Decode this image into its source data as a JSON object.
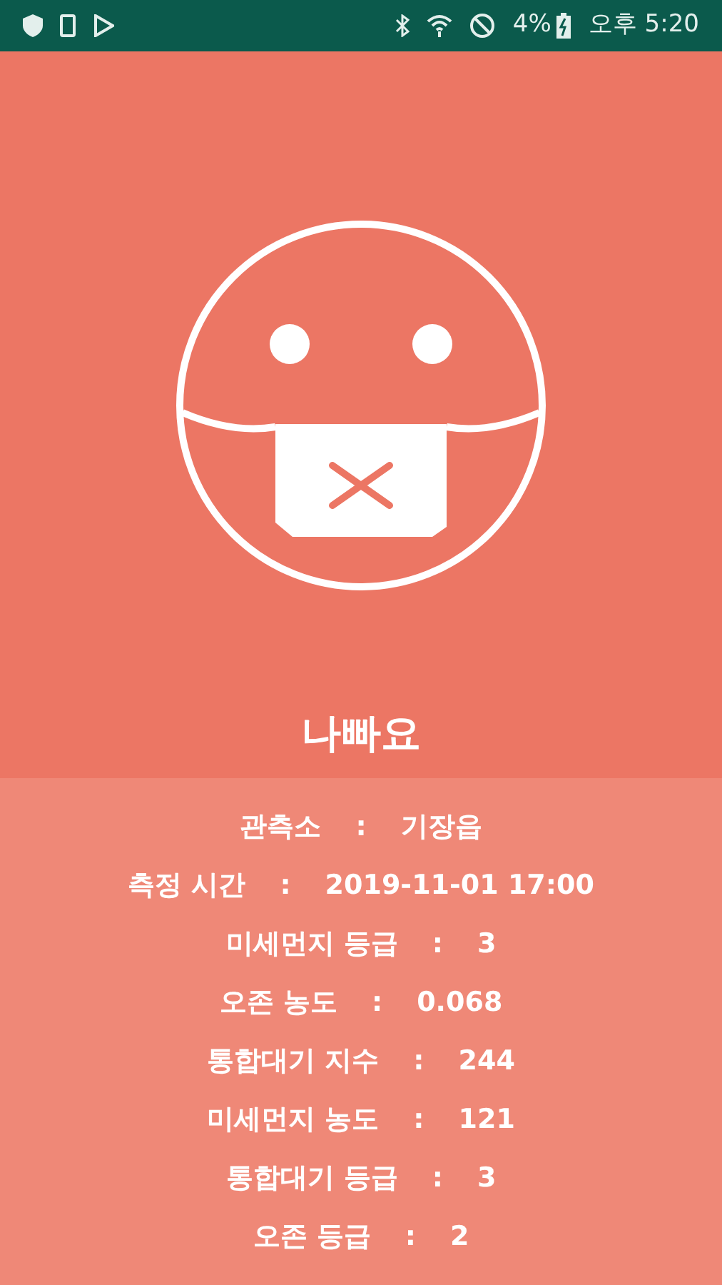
{
  "status_bar": {
    "battery": "4%",
    "time": "오후 5:20"
  },
  "status": {
    "label": "나빠요"
  },
  "details": [
    {
      "label": "관측소",
      "separator": ":",
      "value": "기장읍"
    },
    {
      "label": "측정 시간",
      "separator": ":",
      "value": "2019-11-01 17:00"
    },
    {
      "label": "미세먼지 등급",
      "separator": ":",
      "value": "3"
    },
    {
      "label": "오존 농도",
      "separator": ":",
      "value": "0.068"
    },
    {
      "label": "통합대기 지수",
      "separator": ":",
      "value": "244"
    },
    {
      "label": "미세먼지 농도",
      "separator": ":",
      "value": "121"
    },
    {
      "label": "통합대기 등급",
      "separator": ":",
      "value": "3"
    },
    {
      "label": "오존 등급",
      "separator": ":",
      "value": "2"
    }
  ]
}
